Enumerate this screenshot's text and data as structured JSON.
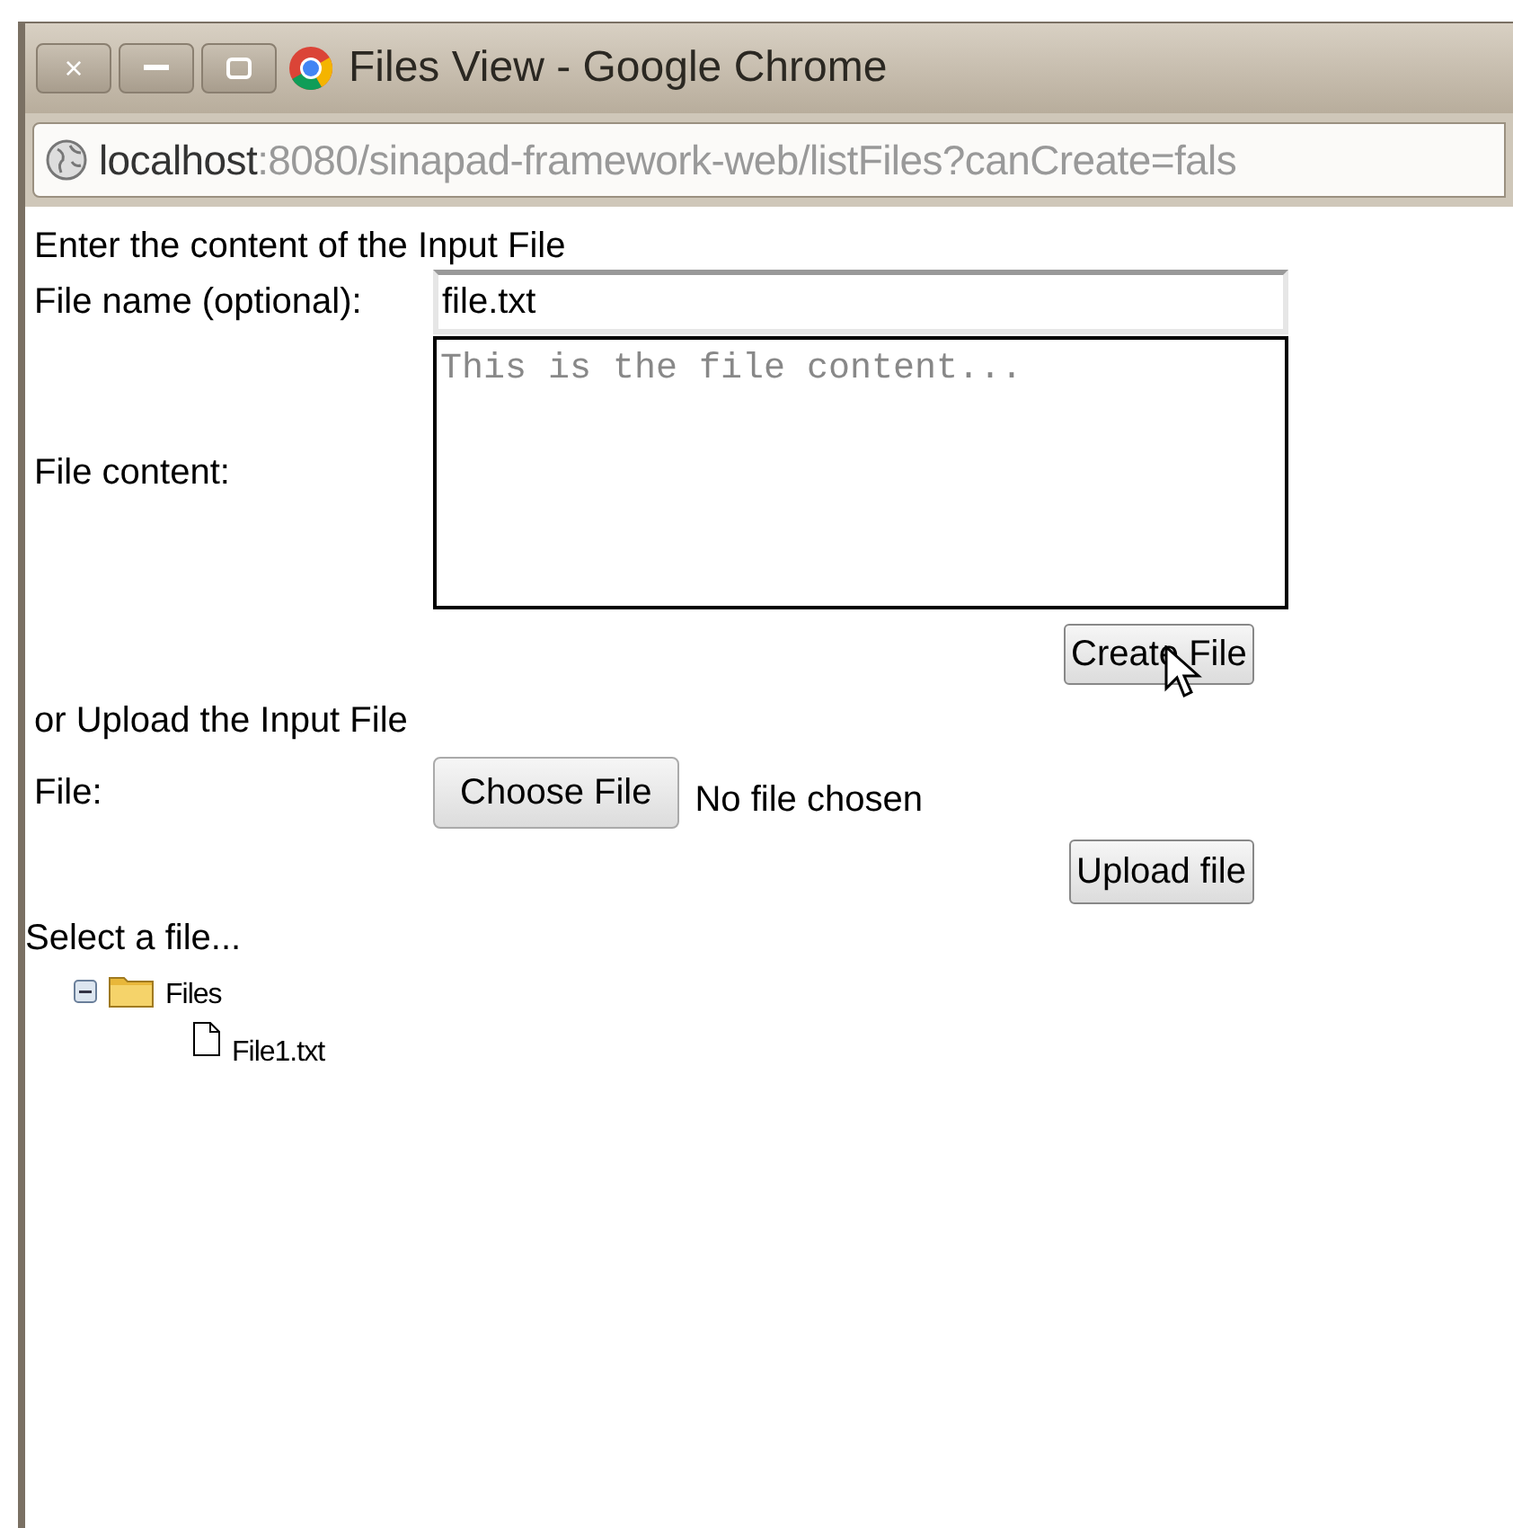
{
  "window": {
    "title": "Files View - Google Chrome",
    "buttons": [
      {
        "kind": "close",
        "label": "×"
      },
      {
        "kind": "minimize"
      },
      {
        "kind": "maximize"
      }
    ]
  },
  "address_bar": {
    "host": "localhost",
    "rest": ":8080/sinapad-framework-web/listFiles?canCreate=fals"
  },
  "create_section": {
    "heading": "Enter the content of the Input File",
    "file_name_label": "File name (optional):",
    "file_name_value": "file.txt",
    "content_label": "File content:",
    "content_placeholder": "This is the file content...",
    "button": "Create File"
  },
  "upload_section": {
    "heading": "or Upload the Input File",
    "file_label": "File:",
    "choose_button": "Choose File",
    "chosen_text": "No file chosen",
    "button": "Upload file"
  },
  "tree": {
    "heading": "Select a file...",
    "items": [
      {
        "kind": "folder",
        "label": "Files",
        "expanded": true,
        "children": [
          {
            "kind": "file",
            "label": "File1.txt"
          }
        ]
      }
    ]
  }
}
